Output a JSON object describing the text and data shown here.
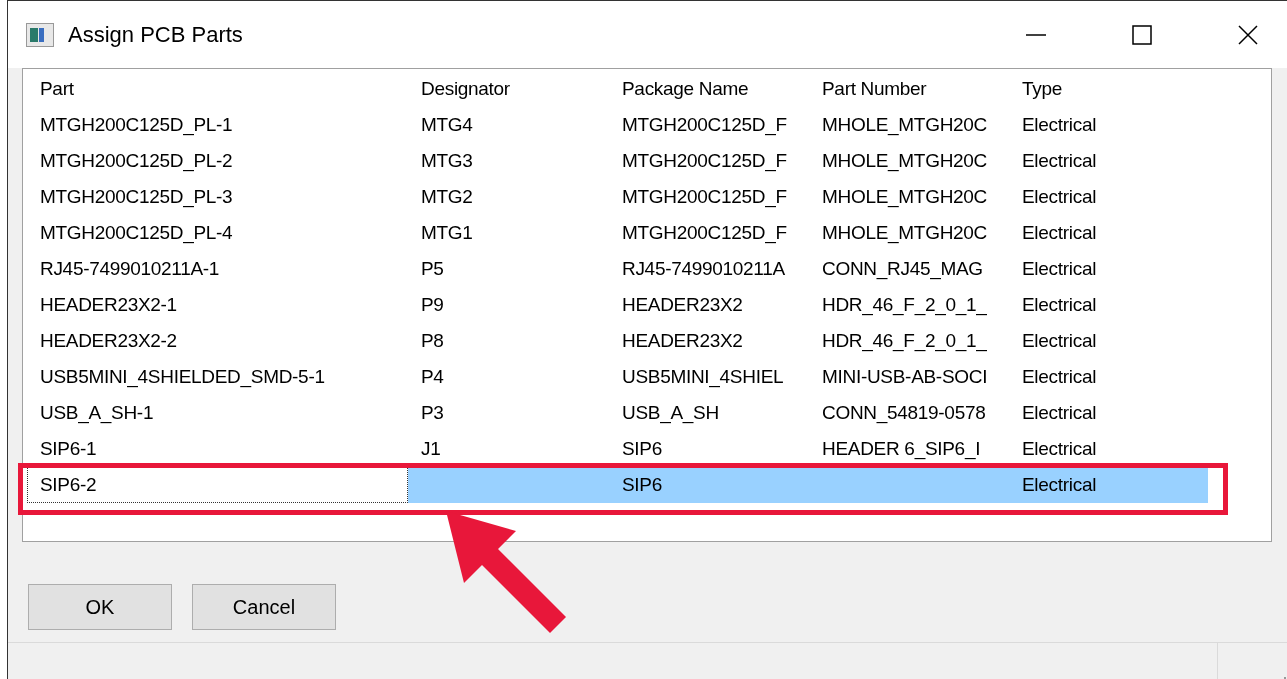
{
  "window": {
    "title": "Assign PCB Parts"
  },
  "table": {
    "columns": [
      "Part",
      "Designator",
      "Package Name",
      "Part Number",
      "Type"
    ],
    "rows": [
      {
        "part": "MTGH200C125D_PL-1",
        "designator": "MTG4",
        "package_name": "MTGH200C125D_F",
        "part_number": "MHOLE_MTGH20C",
        "type": "Electrical",
        "selected": false
      },
      {
        "part": "MTGH200C125D_PL-2",
        "designator": "MTG3",
        "package_name": "MTGH200C125D_F",
        "part_number": "MHOLE_MTGH20C",
        "type": "Electrical",
        "selected": false
      },
      {
        "part": "MTGH200C125D_PL-3",
        "designator": "MTG2",
        "package_name": "MTGH200C125D_F",
        "part_number": "MHOLE_MTGH20C",
        "type": "Electrical",
        "selected": false
      },
      {
        "part": "MTGH200C125D_PL-4",
        "designator": "MTG1",
        "package_name": "MTGH200C125D_F",
        "part_number": "MHOLE_MTGH20C",
        "type": "Electrical",
        "selected": false
      },
      {
        "part": "RJ45-7499010211A-1",
        "designator": "P5",
        "package_name": "RJ45-7499010211A",
        "part_number": "CONN_RJ45_MAG",
        "type": "Electrical",
        "selected": false
      },
      {
        "part": "HEADER23X2-1",
        "designator": "P9",
        "package_name": "HEADER23X2",
        "part_number": "HDR_46_F_2_0_1_",
        "type": "Electrical",
        "selected": false
      },
      {
        "part": "HEADER23X2-2",
        "designator": "P8",
        "package_name": "HEADER23X2",
        "part_number": "HDR_46_F_2_0_1_",
        "type": "Electrical",
        "selected": false
      },
      {
        "part": "USB5MINI_4SHIELDED_SMD-5-1",
        "designator": "P4",
        "package_name": "USB5MINI_4SHIEL",
        "part_number": "MINI-USB-AB-SOCI",
        "type": "Electrical",
        "selected": false
      },
      {
        "part": "USB_A_SH-1",
        "designator": "P3",
        "package_name": "USB_A_SH",
        "part_number": "CONN_54819-0578",
        "type": "Electrical",
        "selected": false
      },
      {
        "part": "SIP6-1",
        "designator": "J1",
        "package_name": "SIP6",
        "part_number": "HEADER 6_SIP6_I",
        "type": "Electrical",
        "selected": false
      },
      {
        "part": "SIP6-2",
        "package_name": "SIP6",
        "type": "Electrical",
        "selected": true
      }
    ]
  },
  "buttons": [
    "OK",
    "Cancel"
  ]
}
